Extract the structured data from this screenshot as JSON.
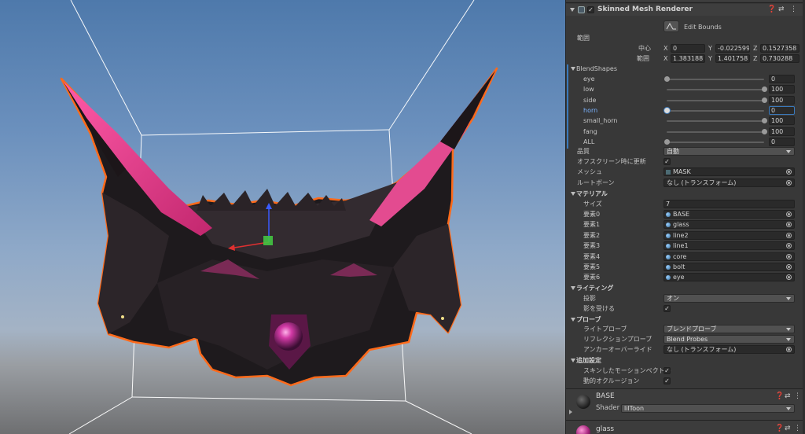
{
  "component": {
    "title": "Skinned Mesh Renderer",
    "edit_bounds": "Edit Bounds",
    "bounds_label": "範囲",
    "center_label": "中心",
    "extent_label": "範囲",
    "axes": [
      "X",
      "Y",
      "Z"
    ],
    "center": {
      "x": "0",
      "y": "-0.0225990",
      "z": "0.1527358"
    },
    "extent": {
      "x": "1.383188",
      "y": "1.401758",
      "z": "0.730288"
    }
  },
  "blendshapes": {
    "header": "BlendShapes",
    "items": [
      {
        "name": "eye",
        "value": "0",
        "level": 0
      },
      {
        "name": "low",
        "value": "100",
        "level": 100
      },
      {
        "name": "side",
        "value": "100",
        "level": 100
      },
      {
        "name": "horn",
        "value": "0",
        "level": 0
      },
      {
        "name": "small_horn",
        "value": "100",
        "level": 100
      },
      {
        "name": "fang",
        "value": "100",
        "level": 100
      },
      {
        "name": "ALL",
        "value": "0",
        "level": 0
      }
    ]
  },
  "settings": {
    "quality_label": "品質",
    "quality_value": "自動",
    "offscreen_label": "オフスクリーン時に更新",
    "mesh_label": "メッシュ",
    "mesh_value": "MASK",
    "rootbone_label": "ルートボーン",
    "rootbone_value": "なし (トランスフォーム)"
  },
  "materials": {
    "header": "マテリアル",
    "size_label": "サイズ",
    "size_value": "7",
    "elements": [
      {
        "label": "要素0",
        "value": "BASE"
      },
      {
        "label": "要素1",
        "value": "glass"
      },
      {
        "label": "要素2",
        "value": "line2"
      },
      {
        "label": "要素3",
        "value": "line1"
      },
      {
        "label": "要素4",
        "value": "core"
      },
      {
        "label": "要素5",
        "value": "bolt"
      },
      {
        "label": "要素6",
        "value": "eye"
      }
    ]
  },
  "lighting": {
    "header": "ライティング",
    "shadow_label": "投影",
    "shadow_value": "オン",
    "receive_label": "影を受ける"
  },
  "probes": {
    "header": "プローブ",
    "light_label": "ライトプローブ",
    "light_value": "ブレンドプローブ",
    "reflection_label": "リフレクションプローブ",
    "reflection_value": "Blend Probes",
    "anchor_label": "アンカーオーバーライド",
    "anchor_value": "なし (トランスフォーム)"
  },
  "additional": {
    "header": "追加設定",
    "motion_label": "スキンしたモーションベクトル",
    "occlusion_label": "動的オクルージョン"
  },
  "material_panels": [
    {
      "name": "BASE",
      "shader_label": "Shader",
      "shader_value": "lilToon"
    },
    {
      "name": "glass"
    }
  ],
  "colors": {
    "selection_accent": "#3a79bb",
    "mask_outline": "#ff6a1a",
    "horn_pink": "#ff4f9e"
  }
}
